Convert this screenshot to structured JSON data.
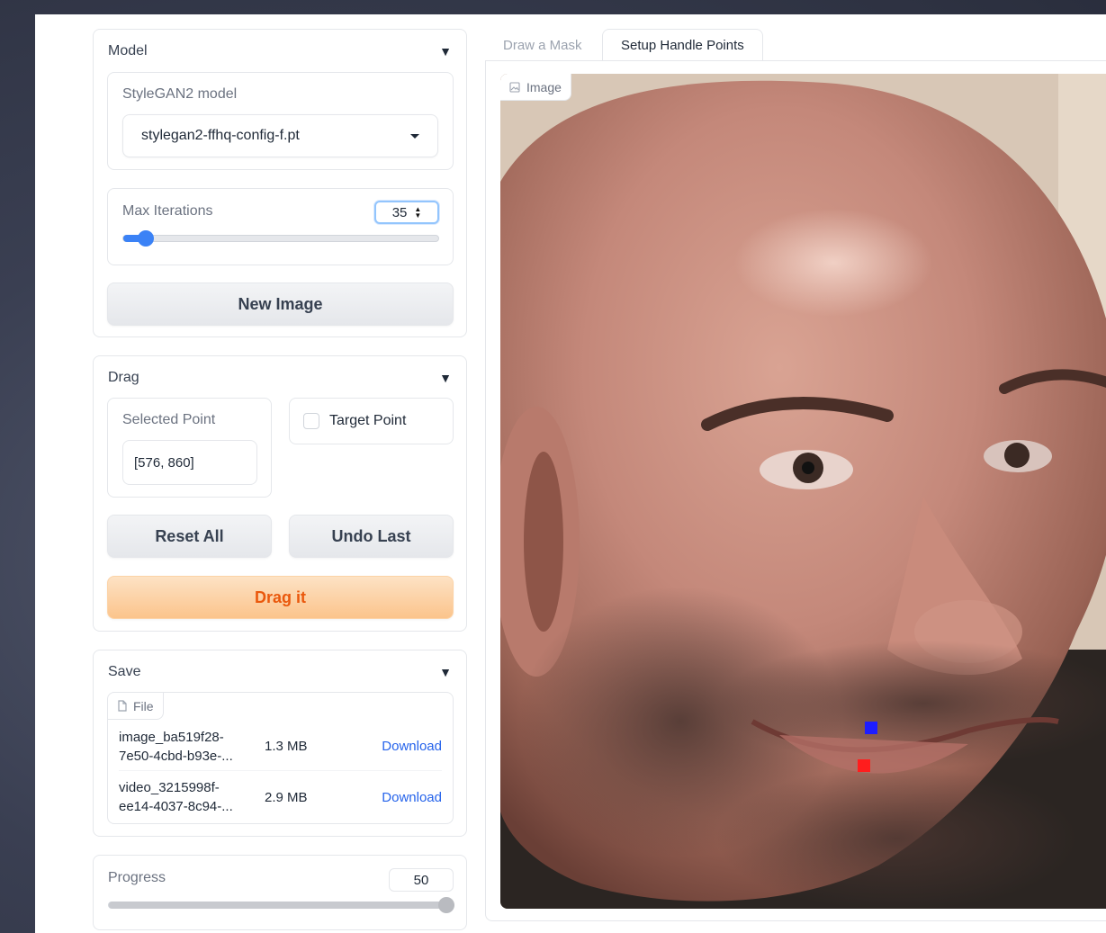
{
  "model": {
    "header": "Model",
    "stylegan_label": "StyleGAN2 model",
    "stylegan_value": "stylegan2-ffhq-config-f.pt",
    "max_iter_label": "Max Iterations",
    "max_iter_value": "35",
    "max_iter_fraction": 0.07,
    "new_image_label": "New Image"
  },
  "drag": {
    "header": "Drag",
    "selected_point_label": "Selected Point",
    "selected_point_value": "[576, 860]",
    "target_point_label": "Target Point",
    "target_point_checked": false,
    "reset_all_label": "Reset All",
    "undo_last_label": "Undo Last",
    "drag_it_label": "Drag it"
  },
  "save": {
    "header": "Save",
    "file_tag": "File",
    "files": [
      {
        "name": "image_ba519f28-7e50-4cbd-b93e-...",
        "size": "1.3 MB",
        "action": "Download"
      },
      {
        "name": "video_3215998f-ee14-4037-8c94-...",
        "size": "2.9 MB",
        "action": "Download"
      }
    ]
  },
  "progress": {
    "label": "Progress",
    "value": "50",
    "fraction": 1.0
  },
  "tabs": [
    {
      "label": "Draw a Mask",
      "active": false
    },
    {
      "label": "Setup Handle Points",
      "active": true
    }
  ],
  "image_panel": {
    "tag": "Image",
    "handle_points": [
      {
        "role": "target",
        "color": "#1d1dff"
      },
      {
        "role": "handle",
        "color": "#ff1d1d"
      }
    ]
  },
  "colors": {
    "accent_blue": "#3b82f6",
    "orange_primary": "#ea580c",
    "link": "#2563eb"
  }
}
